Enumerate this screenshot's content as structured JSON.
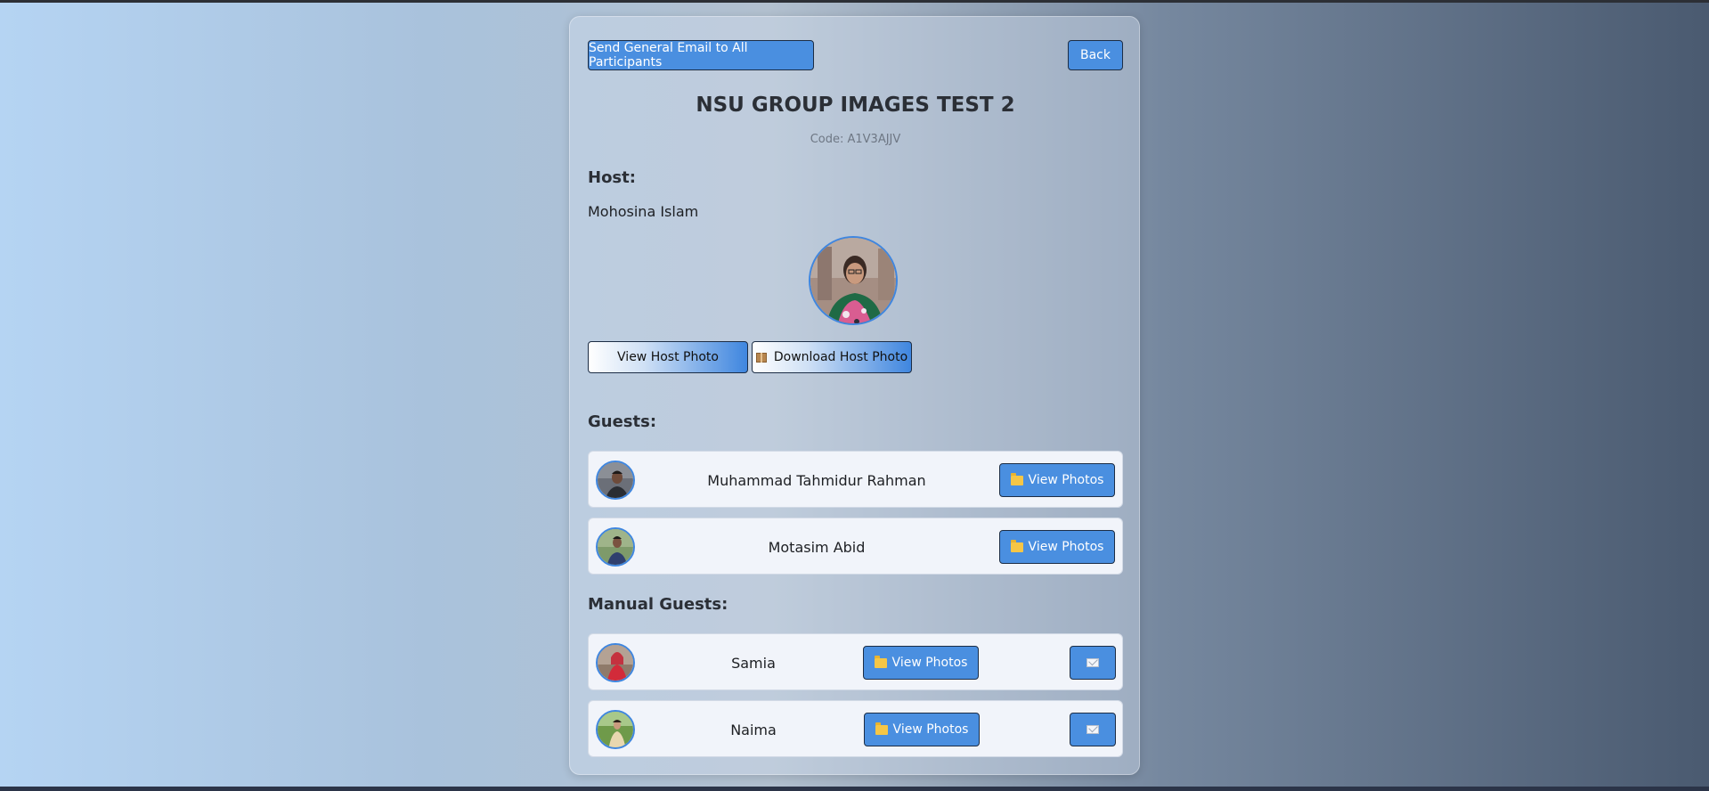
{
  "toolbar": {
    "send_email_label": "Send General Email to All Participants",
    "back_label": "Back"
  },
  "event": {
    "title": "NSU GROUP IMAGES TEST 2",
    "code": "Code: A1V3AJJV"
  },
  "host": {
    "heading": "Host:",
    "name": "Mohosina Islam",
    "view_photo_label": "View Host Photo",
    "download_photo_label": "Download Host Photo"
  },
  "guests": {
    "heading": "Guests:",
    "items": [
      {
        "name": "Muhammad Tahmidur Rahman",
        "button_label": "View Photos"
      },
      {
        "name": "Motasim Abid",
        "button_label": "View Photos"
      }
    ]
  },
  "manual_guests": {
    "heading": "Manual Guests:",
    "items": [
      {
        "name": "Samia",
        "button_label": "View Photos"
      },
      {
        "name": "Naima",
        "button_label": "View Photos"
      }
    ]
  },
  "icons": {
    "folder": "folder-icon",
    "mail": "mail-icon",
    "package": "package-icon"
  },
  "colors": {
    "accent": "#4a8fe0",
    "avatar_border": "#3f86df"
  }
}
